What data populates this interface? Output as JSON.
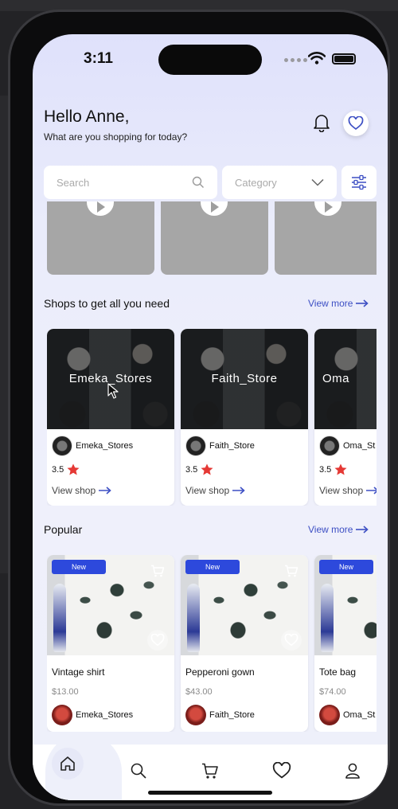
{
  "status_bar": {
    "time": "3:11"
  },
  "header": {
    "greeting": "Hello Anne,",
    "subtitle": "What are you shopping for today?",
    "bell_icon": "bell-icon",
    "wishlist_icon": "heart-icon"
  },
  "search": {
    "placeholder": "Search",
    "icon": "search-icon"
  },
  "category": {
    "placeholder": "Category",
    "icon": "chevron-down-icon"
  },
  "filter": {
    "icon": "sliders-icon"
  },
  "shops_section": {
    "title": "Shops to get all you need",
    "view_more": "View more",
    "items": [
      {
        "banner_name": "Emeka_Stores",
        "store_name": "Emeka_Stores",
        "rating": "3.5",
        "view_shop": "View shop"
      },
      {
        "banner_name": "Faith_Store",
        "store_name": "Faith_Store",
        "rating": "3.5",
        "view_shop": "View shop"
      },
      {
        "banner_name": "Oma",
        "store_name": "Oma_St",
        "rating": "3.5",
        "view_shop": "View shop"
      }
    ]
  },
  "popular_section": {
    "title": "Popular",
    "view_more": "View more",
    "items": [
      {
        "badge": "New",
        "name": "Vintage shirt",
        "price": "$13.00",
        "store": "Emeka_Stores"
      },
      {
        "badge": "New",
        "name": "Pepperoni gown",
        "price": "$43.00",
        "store": "Faith_Store"
      },
      {
        "badge": "New",
        "name": "Tote bag",
        "price": "$74.00",
        "store": "Oma_St"
      }
    ]
  },
  "tab_bar": {
    "items": [
      "home-icon",
      "search-icon",
      "cart-icon",
      "heart-icon",
      "user-icon"
    ]
  },
  "colors": {
    "accent": "#3d4fc4",
    "badge": "#2d49dc",
    "star": "#e53935"
  }
}
